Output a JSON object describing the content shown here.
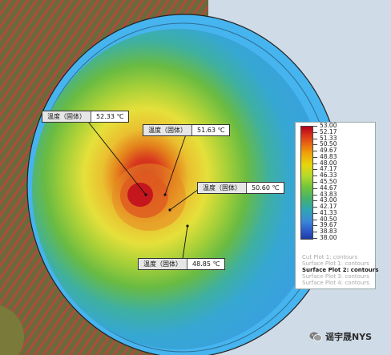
{
  "probes": [
    {
      "label": "温度（固体）",
      "value": "52.33 ℃"
    },
    {
      "label": "温度（固体）",
      "value": "51.63 ℃"
    },
    {
      "label": "温度（固体）",
      "value": "50.60 ℃"
    },
    {
      "label": "温度（固体）",
      "value": "48.85 ℃"
    }
  ],
  "legend": {
    "ticks": [
      "53.00",
      "52.17",
      "51.33",
      "50.50",
      "49.67",
      "48.83",
      "48.00",
      "47.17",
      "46.33",
      "45.50",
      "44.67",
      "43.83",
      "43.00",
      "42.17",
      "41.33",
      "40.50",
      "39.67",
      "38.83",
      "38.00"
    ],
    "plots": [
      {
        "label": "Cut Plot 1: contours",
        "active": false
      },
      {
        "label": "Surface Plot 1: contours",
        "active": false
      },
      {
        "label": "Surface Plot 2: contours",
        "active": true
      },
      {
        "label": "Surface Plot 3: contours",
        "active": false
      },
      {
        "label": "Surface Plot 4: contours",
        "active": false
      }
    ]
  },
  "watermark": {
    "text": "谣宇晟NYS",
    "icon": "wechat-icon"
  },
  "colors": {
    "hot": "#c4161c",
    "cool": "#3aa3dc",
    "background": "#cfdbe6"
  }
}
